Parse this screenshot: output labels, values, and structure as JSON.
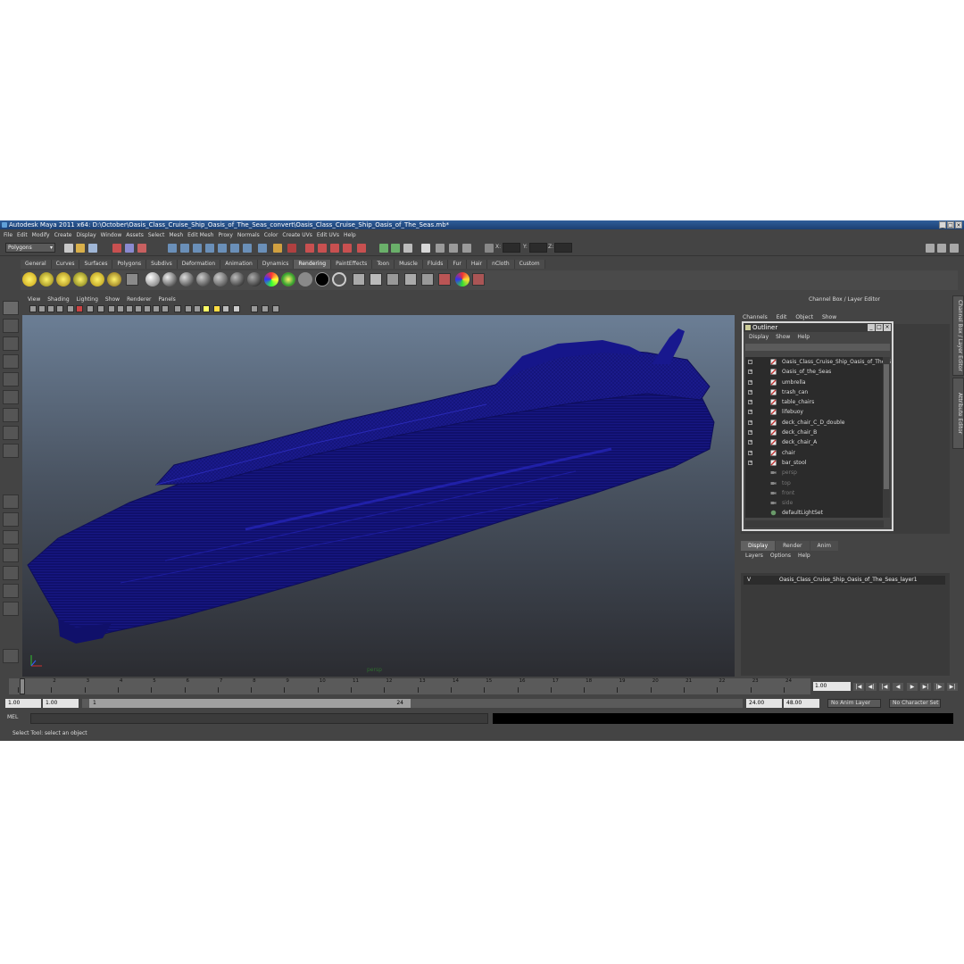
{
  "window": {
    "title": "Autodesk Maya 2011 x64: D:\\October\\Oasis_Class_Cruise_Ship_Oasis_of_The_Seas_convert\\Oasis_Class_Cruise_Ship_Oasis_of_The_Seas.mb*"
  },
  "menubar": [
    "File",
    "Edit",
    "Modify",
    "Create",
    "Display",
    "Window",
    "Assets",
    "Select",
    "Mesh",
    "Edit Mesh",
    "Proxy",
    "Normals",
    "Color",
    "Create UVs",
    "Edit UVs",
    "Help"
  ],
  "status": {
    "mode": "Polygons",
    "x_label": "X:",
    "y_label": "Y:",
    "z_label": "Z:"
  },
  "shelf": {
    "tabs": [
      "General",
      "Curves",
      "Surfaces",
      "Polygons",
      "Subdivs",
      "Deformation",
      "Animation",
      "Dynamics",
      "Rendering",
      "PaintEffects",
      "Toon",
      "Muscle",
      "Fluids",
      "Fur",
      "Hair",
      "nCloth",
      "Custom"
    ],
    "active": "Rendering"
  },
  "panel": {
    "menu": [
      "View",
      "Shading",
      "Lighting",
      "Show",
      "Renderer",
      "Panels"
    ],
    "camera": "persp"
  },
  "channel_box": {
    "header": "Channel Box / Layer Editor",
    "menu": [
      "Channels",
      "Edit",
      "Object",
      "Show"
    ]
  },
  "side_tabs": [
    "Channel Box / Layer Editor",
    "Attribute Editor"
  ],
  "outliner": {
    "title": "Outliner",
    "menu": [
      "Display",
      "Show",
      "Help"
    ],
    "items": [
      {
        "label": "Oasis_Class_Cruise_Ship_Oasis_of_The_S",
        "expand": "-",
        "dim": false
      },
      {
        "label": "Oasis_of_the_Seas",
        "expand": "+",
        "dim": false
      },
      {
        "label": "umbrella",
        "expand": "+",
        "dim": false
      },
      {
        "label": "trash_can",
        "expand": "+",
        "dim": false
      },
      {
        "label": "table_chairs",
        "expand": "+",
        "dim": false
      },
      {
        "label": "lifebuoy",
        "expand": "+",
        "dim": false
      },
      {
        "label": "deck_chair_C_D_double",
        "expand": "+",
        "dim": false
      },
      {
        "label": "deck_chair_B",
        "expand": "+",
        "dim": false
      },
      {
        "label": "deck_chair_A",
        "expand": "+",
        "dim": false
      },
      {
        "label": "chair",
        "expand": "+",
        "dim": false
      },
      {
        "label": "bar_stool",
        "expand": "+",
        "dim": false
      },
      {
        "label": "persp",
        "expand": "",
        "dim": true
      },
      {
        "label": "top",
        "expand": "",
        "dim": true
      },
      {
        "label": "front",
        "expand": "",
        "dim": true
      },
      {
        "label": "side",
        "expand": "",
        "dim": true
      },
      {
        "label": "defaultLightSet",
        "expand": "",
        "dim": false
      }
    ]
  },
  "layer_editor": {
    "tabs": [
      "Display",
      "Render",
      "Anim"
    ],
    "active": "Display",
    "menu": [
      "Layers",
      "Options",
      "Help"
    ],
    "layer": {
      "visible": "V",
      "name": "Oasis_Class_Cruise_Ship_Oasis_of_The_Seas_layer1"
    }
  },
  "timeline": {
    "ticks": [
      "1",
      "2",
      "3",
      "4",
      "5",
      "6",
      "7",
      "8",
      "9",
      "10",
      "11",
      "12",
      "13",
      "14",
      "15",
      "16",
      "17",
      "18",
      "19",
      "20",
      "21",
      "22",
      "23",
      "24"
    ],
    "current_frame": "1.00",
    "start": "1.00",
    "start2": "1.00",
    "range_start_label": "1",
    "range_end_label": "24",
    "end": "24.00",
    "end2": "48.00",
    "anim_layer": "No Anim Layer",
    "character_set": "No Character Set"
  },
  "command": {
    "label": "MEL"
  },
  "help_line": "Select Tool: select an object"
}
